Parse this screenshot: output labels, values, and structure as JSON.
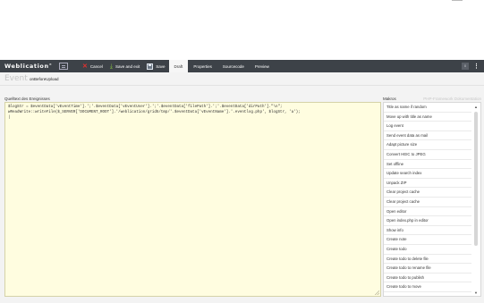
{
  "app": {
    "brand": "Weblication",
    "brand_mark": "®"
  },
  "toolbar": {
    "cancel_label": "Cancel",
    "save_exit_label": "Save and exit",
    "save_label": "Save",
    "tabs": [
      {
        "label": "Draft",
        "active": true
      },
      {
        "label": "Properties",
        "active": false
      },
      {
        "label": "Sourcecode",
        "active": false
      },
      {
        "label": "Preview",
        "active": false
      }
    ],
    "notification_count": "0"
  },
  "event": {
    "label": "Event",
    "name": "onBeforeUpload"
  },
  "source": {
    "label": "Quelltext des Ereignisses",
    "code": "$logStr = $eventData['vEventTime'].';'.$eventData['vEventUser'].';'.$eventData['filePath'].';'.$eventData['dirPath'].\"\\n\";\nwReadWrite::writeFile($_SERVER['DOCUMENT_ROOT'].'/weblication/grid5/tmp/'.$eventData['vEventName'].'.eventlog.php', $logStr, 'a');\n|"
  },
  "macros": {
    "title": "Makros",
    "reference_link": "PHP-Framework Dokumentation",
    "items": [
      "Title as name if random",
      "Move up with title as name",
      "Log event",
      "Send event data as mail",
      "Adapt picture size",
      "Convert HEIC to JPEG",
      "Set offline",
      "Update search index",
      "Unpack ZIP",
      "Clear project cache",
      "Clear project cache",
      "Open editor",
      "Open index.php in editor",
      "Show info",
      "Create note",
      "Create todo",
      "Create todo to delete file",
      "Create todo to rename file",
      "Create todo to publish",
      "Create todo to move"
    ]
  },
  "colors": {
    "toolbar_bg": "#3d4248",
    "editor_bg": "#fffde0",
    "cancel_icon": "#e2302f",
    "save_exit_icon": "#8ac43f"
  },
  "icons": {
    "layout": "layout-toggle-icon",
    "cancel": "x-icon",
    "save_exit": "save-and-exit-icon",
    "save": "floppy-disk-icon",
    "more": "more-vertical-icon"
  }
}
